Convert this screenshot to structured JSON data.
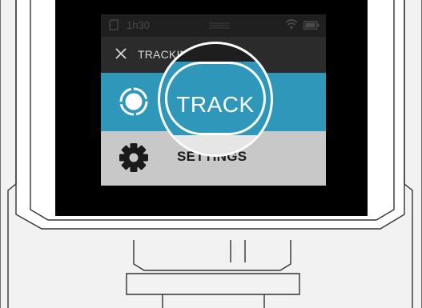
{
  "status_bar": {
    "time": "1h30",
    "sd_icon": "sd-card-icon",
    "wifi_icon": "wifi-icon",
    "battery_icon": "battery-icon"
  },
  "header": {
    "title": "TRACKING",
    "close_icon": "close-icon"
  },
  "menu": {
    "items": [
      {
        "label": "TRACK",
        "icon": "target-icon",
        "selected": true
      },
      {
        "label": "SETTINGS",
        "icon": "gear-icon",
        "selected": false
      }
    ]
  },
  "colors": {
    "accent": "#2f97b9",
    "header_bg": "#2b2b2b",
    "settings_bg": "#c8c8c8"
  }
}
